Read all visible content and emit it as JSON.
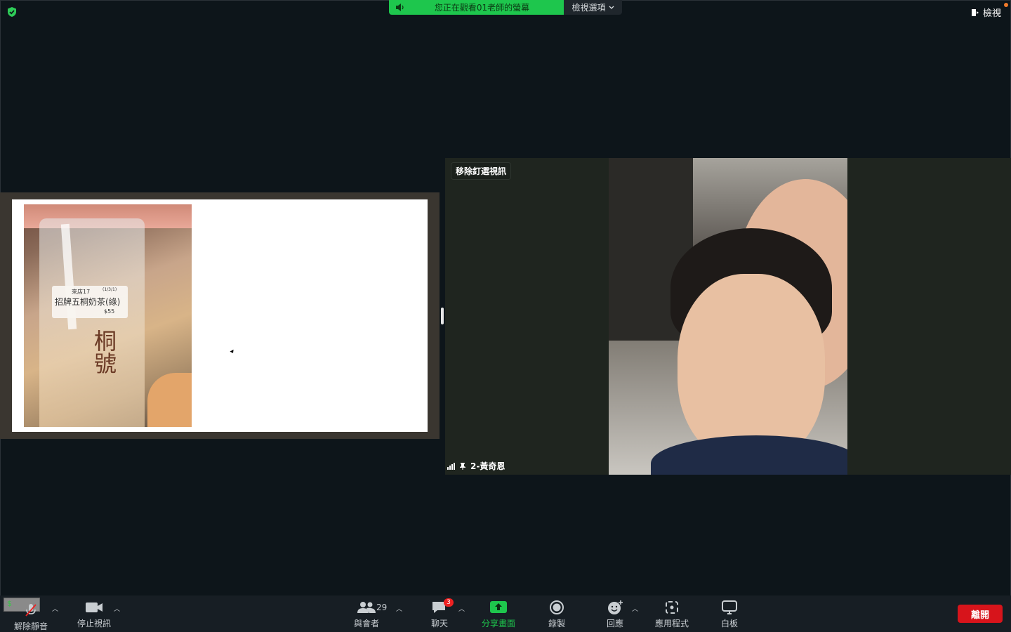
{
  "top_bar": {
    "banner_text": "您正在觀看01老師的螢幕",
    "view_options_label": "檢視選項",
    "view_button_label": "檢視"
  },
  "shared_screen": {
    "label": {
      "line1": "來店17",
      "line1b": "(1/3/1)",
      "line2": "招牌五桐奶茶(綠)",
      "line3": "$55"
    },
    "brand": "桐號"
  },
  "video": {
    "pin_label": "移除釘選視訊",
    "participant_name": "2-黃奇恩"
  },
  "toolbar": {
    "mini_preview_text": "$",
    "unmute_label": "解除靜音",
    "stop_video_label": "停止視訊",
    "participants_label": "與會者",
    "participants_count": "29",
    "chat_label": "聊天",
    "chat_badge": "3",
    "share_label": "分享畫面",
    "record_label": "錄製",
    "reactions_label": "回應",
    "apps_label": "應用程式",
    "whiteboard_label": "白板",
    "leave_label": "離開"
  },
  "colors": {
    "background": "#0d151a",
    "share_green": "#1ec64d",
    "leave_red": "#d7141b",
    "toolbar_bg": "#171e24"
  }
}
